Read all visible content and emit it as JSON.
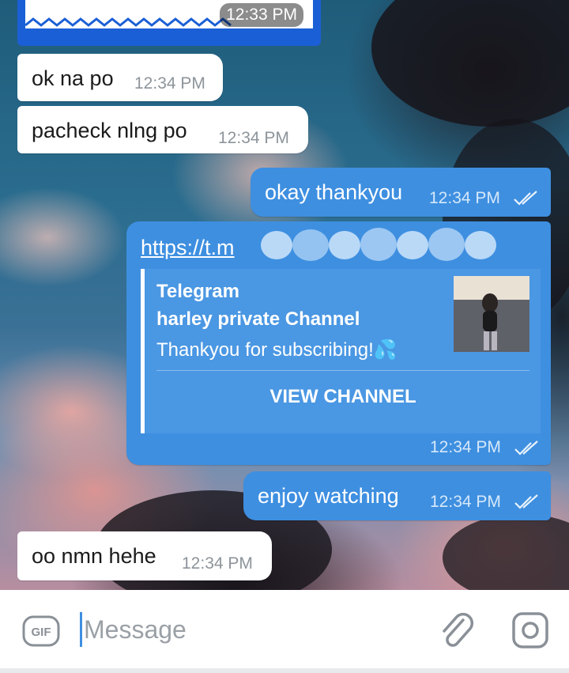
{
  "messages": {
    "top_image": {
      "time": "12:33 PM"
    },
    "m1": {
      "text": "ok na po",
      "time": "12:34 PM"
    },
    "m2": {
      "text": "pacheck nlng po",
      "time": "12:34 PM"
    },
    "m3": {
      "text": "okay thankyou",
      "time": "12:34 PM"
    },
    "link": {
      "url_visible": "https://t.m",
      "site_name": "Telegram",
      "title": "harley private Channel",
      "description": "Thankyou for subscribing!💦",
      "button_label": "VIEW CHANNEL",
      "time": "12:34 PM"
    },
    "m4": {
      "text": "enjoy watching",
      "time": "12:34 PM"
    },
    "m5": {
      "text": "oo nmn hehe",
      "time": "12:34 PM"
    }
  },
  "input": {
    "placeholder": "Message",
    "gif_label": "GIF"
  },
  "colors": {
    "outgoing_bubble": "#3e8fe0",
    "incoming_bubble": "#ffffff",
    "image_frame": "#1b5fd6"
  },
  "icons": [
    "gif-icon",
    "paperclip-icon",
    "camera-icon",
    "double-check-icon"
  ]
}
